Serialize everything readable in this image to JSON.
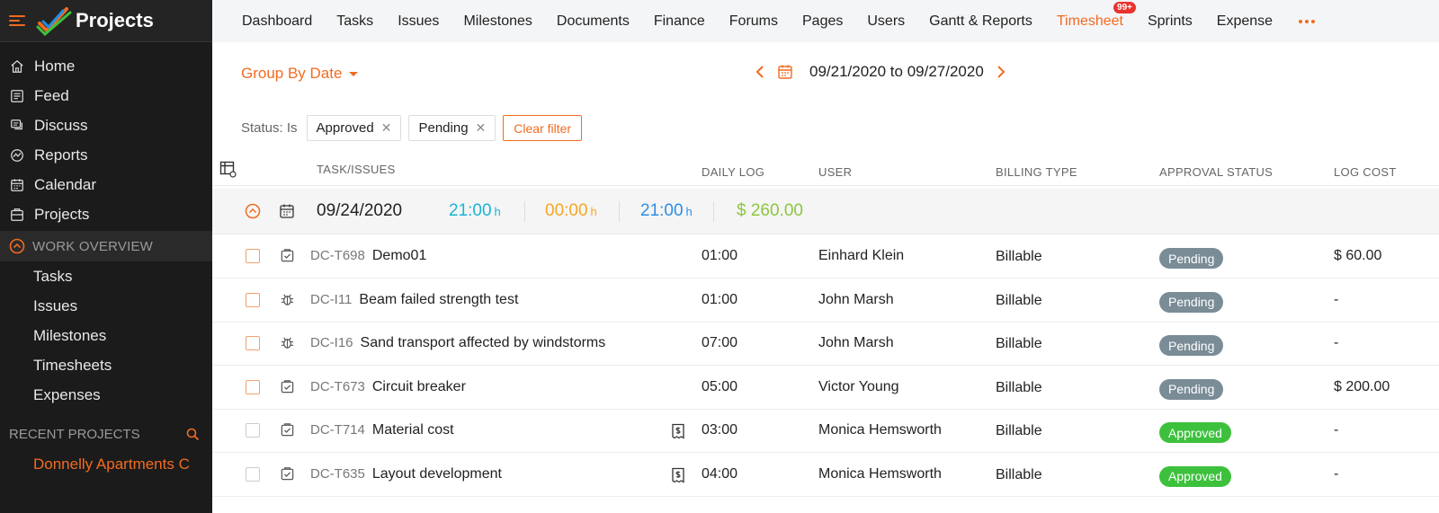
{
  "app": {
    "title": "Projects"
  },
  "sidebar": {
    "main_items": [
      {
        "label": "Home",
        "icon": "home-icon"
      },
      {
        "label": "Feed",
        "icon": "feed-icon"
      },
      {
        "label": "Discuss",
        "icon": "discuss-icon"
      },
      {
        "label": "Reports",
        "icon": "reports-icon"
      },
      {
        "label": "Calendar",
        "icon": "calendar-icon"
      },
      {
        "label": "Projects",
        "icon": "projects-icon"
      }
    ],
    "work_overview": {
      "label": "WORK OVERVIEW",
      "items": [
        "Tasks",
        "Issues",
        "Milestones",
        "Timesheets",
        "Expenses"
      ]
    },
    "recent_projects": {
      "label": "RECENT PROJECTS",
      "items": [
        "Donnelly Apartments C"
      ]
    }
  },
  "topnav": {
    "tabs": [
      "Dashboard",
      "Tasks",
      "Issues",
      "Milestones",
      "Documents",
      "Finance",
      "Forums",
      "Pages",
      "Users",
      "Gantt & Reports",
      "Timesheet",
      "Sprints",
      "Expense"
    ],
    "active_tab": "Timesheet",
    "timesheet_badge": "99+"
  },
  "toolbar": {
    "group_by": "Group By Date",
    "date_range": "09/21/2020 to 09/27/2020"
  },
  "filters": {
    "label": "Status: Is",
    "chips": [
      "Approved",
      "Pending"
    ],
    "clear_label": "Clear filter"
  },
  "table": {
    "headers": {
      "task": "TASK/ISSUES",
      "daily_log": "DAILY LOG",
      "user": "USER",
      "billing": "BILLING TYPE",
      "approval": "APPROVAL STATUS",
      "cost": "LOG COST"
    },
    "group": {
      "date": "09/24/2020",
      "total_hours": "21:00",
      "non_billable_hours": "00:00",
      "billable_hours": "21:00",
      "hours_unit": "h",
      "cost": "$ 260.00"
    },
    "rows": [
      {
        "code": "DC-T698",
        "name": "Demo01",
        "type": "task",
        "log": "01:00",
        "user": "Einhard Klein",
        "billing": "Billable",
        "status": "Pending",
        "cost": "$ 60.00",
        "receipt": false
      },
      {
        "code": "DC-I11",
        "name": "Beam failed strength test",
        "type": "issue",
        "log": "01:00",
        "user": "John Marsh",
        "billing": "Billable",
        "status": "Pending",
        "cost": "-",
        "receipt": false
      },
      {
        "code": "DC-I16",
        "name": "Sand transport affected by windstorms",
        "type": "issue",
        "log": "07:00",
        "user": "John Marsh",
        "billing": "Billable",
        "status": "Pending",
        "cost": "-",
        "receipt": false
      },
      {
        "code": "DC-T673",
        "name": "Circuit breaker",
        "type": "task",
        "log": "05:00",
        "user": "Victor Young",
        "billing": "Billable",
        "status": "Pending",
        "cost": "$ 200.00",
        "receipt": false
      },
      {
        "code": "DC-T714",
        "name": "Material cost",
        "type": "task",
        "log": "03:00",
        "user": "Monica Hemsworth",
        "billing": "Billable",
        "status": "Approved",
        "cost": "-",
        "receipt": true
      },
      {
        "code": "DC-T635",
        "name": "Layout development",
        "type": "task",
        "log": "04:00",
        "user": "Monica Hemsworth",
        "billing": "Billable",
        "status": "Approved",
        "cost": "-",
        "receipt": true
      }
    ]
  },
  "colors": {
    "accent": "#f26b21",
    "billable": "#1ab3d6",
    "pending": "#7a8c96",
    "approved": "#3dc13d",
    "total_hours": "#1ab3d6",
    "non_billable": "#f5a623",
    "billable_hours": "#2e8ee6",
    "cost": "#8cc63f"
  }
}
